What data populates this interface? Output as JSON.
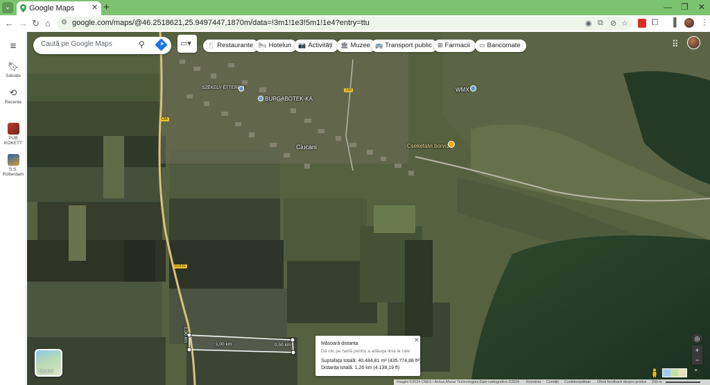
{
  "browser": {
    "tab_title": "Google Maps",
    "url": "google.com/maps/@46.2518621,25.9497447,1870m/data=!3m1!1e3!5m1!1e4?entry=ttu",
    "new_tab": "+",
    "tab_close": "✕",
    "win_min": "—",
    "win_max": "❐",
    "win_close": "✕"
  },
  "sidebar": {
    "menu_icon": "≡",
    "items": [
      {
        "label": "Salvate",
        "icon": "bookmark-icon"
      },
      {
        "label": "Recente",
        "icon": "history-icon"
      },
      {
        "label": "PUB KOKETT",
        "icon": "place-thumbnail"
      },
      {
        "label": "S.S. Rotterdam",
        "icon": "place-thumbnail"
      }
    ]
  },
  "search": {
    "placeholder": "Caută pe Google Maps"
  },
  "chips": [
    {
      "label": "Restaurante",
      "icon": "🍴"
    },
    {
      "label": "Hoteluri",
      "icon": "🛏"
    },
    {
      "label": "Activități",
      "icon": "📷"
    },
    {
      "label": "Muzee",
      "icon": "🏛"
    },
    {
      "label": "Transport public",
      "icon": "🚌"
    },
    {
      "label": "Farmacii",
      "icon": "⊞"
    },
    {
      "label": "Bancomate",
      "icon": "▭"
    }
  ],
  "map_labels": {
    "place_1": "Ciucani",
    "place_2": "BURGABOTEK-KA",
    "place_3": "WMX",
    "place_4": "Csekefalvi borvíz",
    "place_5": "SZÉKELY ÉTTEREM",
    "road_1": "130",
    "road_2": "13A",
    "road_3": "DJ131"
  },
  "measure_line": {
    "seg_1": "1,00 km",
    "seg_2": "0,50 km",
    "seg_3": "1,00 km"
  },
  "layers": {
    "label": "Straturi"
  },
  "measure_card": {
    "title": "Măsoară distanța",
    "hint": "Dă clic pe hartă pentru a adăuga linia la cale",
    "area": "Suprafața totală: 40.484,81 m² (435.774,88 ft²)",
    "distance": "Distanța totală: 1,26 km (4.138,19 ft)",
    "close": "✕"
  },
  "controls": {
    "locate": "◎",
    "zoom_in": "+",
    "zoom_out": "−",
    "expand": "⌃"
  },
  "attribution": {
    "imagery": "Imagini ©2024 CNES / Airbus,Maxar Technologies,Date cartografice ©2024",
    "country": "România",
    "terms": "Condiții",
    "privacy": "Confidențialitate",
    "feedback": "Oferă feedback despre produs",
    "scale": "200 m"
  },
  "colors": {
    "tab_strip": "#7dc270",
    "accent_blue": "#1a73e8",
    "road_yellow": "#f2c230",
    "place_pin_blue": "#6f97c8",
    "poi_gold": "#f2a900"
  }
}
